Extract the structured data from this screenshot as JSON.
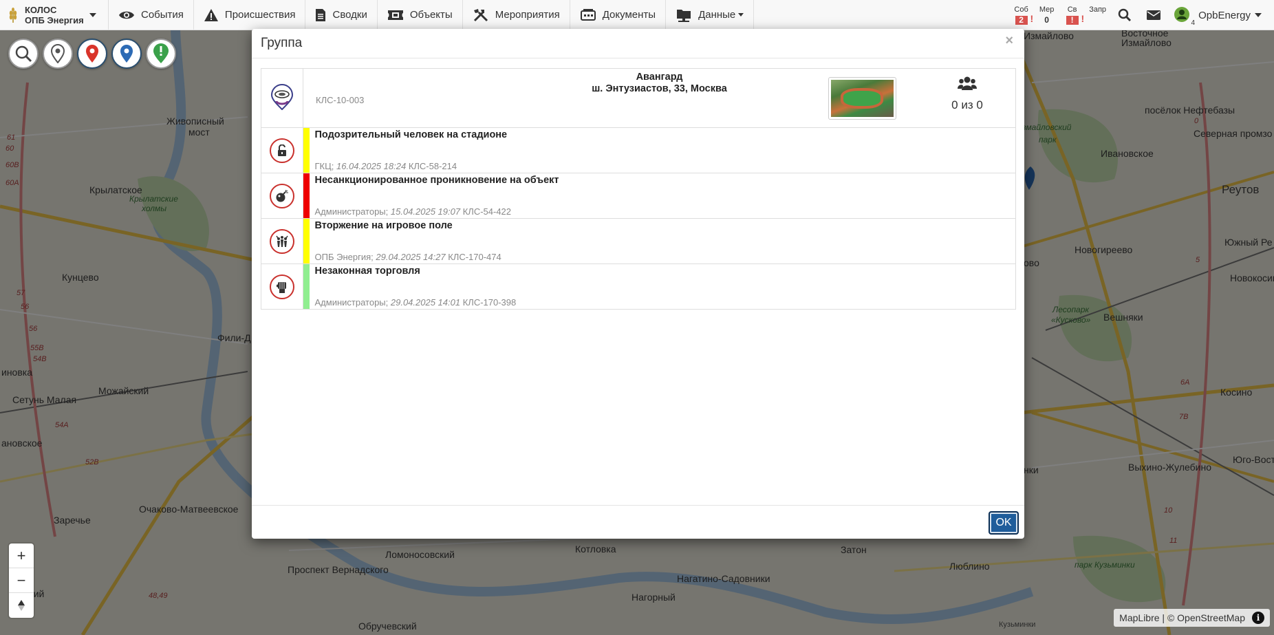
{
  "brand": {
    "line1": "КОЛОС",
    "line2": "ОПБ Энергия"
  },
  "nav": [
    {
      "label": "События",
      "icon": "eye-icon"
    },
    {
      "label": "Происшествия",
      "icon": "warning-icon"
    },
    {
      "label": "Сводки",
      "icon": "document-icon"
    },
    {
      "label": "Объекты",
      "icon": "ticket-icon"
    },
    {
      "label": "Мероприятия",
      "icon": "tools-icon"
    },
    {
      "label": "Документы",
      "icon": "doc-box-icon"
    },
    {
      "label": "Данные",
      "icon": "data-icon"
    }
  ],
  "counters": [
    {
      "label": "Соб",
      "value": "2",
      "alert": true
    },
    {
      "label": "Мер",
      "value": "0",
      "alert": false
    },
    {
      "label": "Св",
      "value": "!",
      "alert": true
    },
    {
      "label": "Запр",
      "value": "",
      "alert": false
    }
  ],
  "user": {
    "name": "OpbEnergy",
    "badge_count": "4"
  },
  "modal": {
    "title": "Группа",
    "close": "×",
    "ok_label": "OK",
    "object": {
      "name": "Авангард",
      "address": "ш. Энтузиастов, 33, Москва",
      "code": "КЛС-10-003",
      "people": "0 из 0"
    },
    "events": [
      {
        "title": "Подозрительный человек на стадионе",
        "org": "ГКЦ;",
        "datetime": "16.04.2025 18:24",
        "code": "КЛС-58-214",
        "color": "#ffff00",
        "icon": "unlock-icon"
      },
      {
        "title": "Несанкционированное проникновение на объект",
        "org": "Администраторы;",
        "datetime": "15.04.2025 19:07",
        "code": "КЛС-54-422",
        "color": "#ee0000",
        "icon": "bomb-icon"
      },
      {
        "title": "Вторжение на игровое поле",
        "org": "ОПБ Энергия;",
        "datetime": "29.04.2025 14:27",
        "code": "КЛС-170-474",
        "color": "#ffff00",
        "icon": "crowd-icon"
      },
      {
        "title": "Незаконная торговля",
        "org": "Администраторы;",
        "datetime": "29.04.2025 14:01",
        "code": "КЛС-170-398",
        "color": "#90ee90",
        "icon": "fist-icon"
      }
    ]
  },
  "map": {
    "labels": [
      "Живописный мост",
      "Крылатское",
      "Крылатские холмы",
      "Кунцево",
      "Фили-Д",
      "иновка",
      "Сетунь Малая",
      "Можайский",
      "ановское",
      "Заречье",
      "Очаково-Матвеевское",
      "ерский",
      "Ломоносовский",
      "Проспект Вернадского",
      "Котловка",
      "Нагатино-Садовники",
      "Нагорный",
      "Обручевский",
      "Затон",
      "Люблино",
      "Измайлово",
      "Восточное Измайлово",
      "посёлок Нефтебазы",
      "Измайловский парк",
      "Северная промзона",
      "Ивановское",
      "Реутов",
      "Новогиреево",
      "Южный Ре",
      "Новокосино",
      "Лесопарк «Кусково»",
      "Вешняки",
      "ово",
      "Косино",
      "Выхино-Жулебино",
      "Юго-Восточная",
      "нки",
      "парк Кузьминки",
      "Кузьминки"
    ],
    "attribution": "MapLibre | © OpenStreetMap",
    "info": "i"
  },
  "tools": [
    "search-tool",
    "grey-pin-tool",
    "red-pin-tool",
    "blue-pin-tool",
    "green-pin-tool"
  ]
}
